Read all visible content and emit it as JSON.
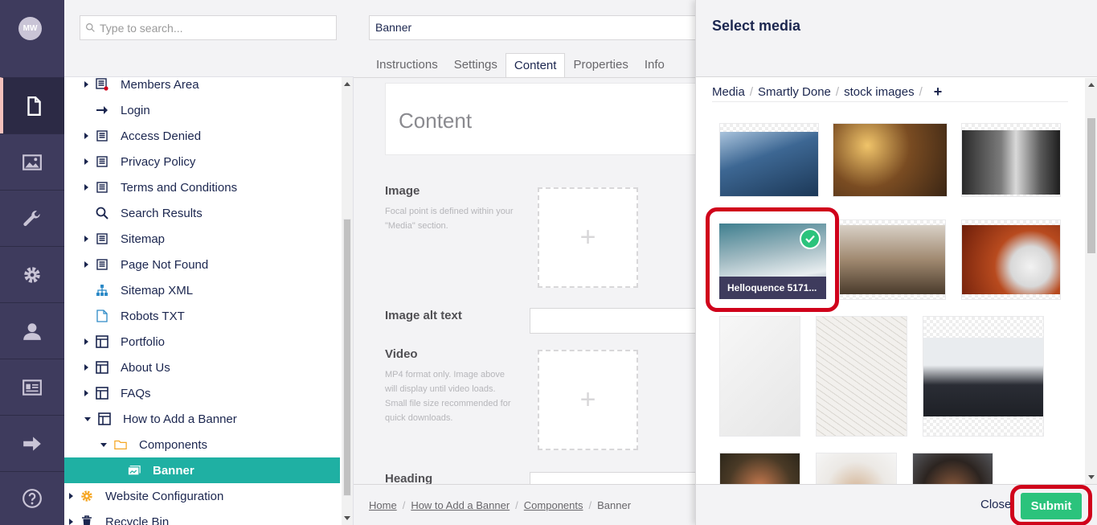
{
  "user": {
    "initials": "MW"
  },
  "sections": [
    {
      "name": "content",
      "icon": "document-icon",
      "active": true
    },
    {
      "name": "media",
      "icon": "image-icon"
    },
    {
      "name": "settings",
      "icon": "wrench-icon"
    },
    {
      "name": "packages",
      "icon": "gear-icon"
    },
    {
      "name": "users",
      "icon": "user-icon"
    },
    {
      "name": "members",
      "icon": "id-card-icon"
    },
    {
      "name": "forms",
      "icon": "arrow-right-icon"
    },
    {
      "name": "help",
      "icon": "help-icon"
    }
  ],
  "tree": {
    "search_placeholder": "Type to search...",
    "items": [
      {
        "label": "Members Area",
        "icon": "page-locked-icon",
        "caret": "right",
        "indent": 1
      },
      {
        "label": "Login",
        "icon": "arrow-right-icon",
        "caret": "none",
        "indent": 1
      },
      {
        "label": "Access Denied",
        "icon": "page-icon",
        "caret": "right",
        "indent": 1
      },
      {
        "label": "Privacy Policy",
        "icon": "page-icon",
        "caret": "right",
        "indent": 1
      },
      {
        "label": "Terms and Conditions",
        "icon": "page-icon",
        "caret": "right",
        "indent": 1
      },
      {
        "label": "Search Results",
        "icon": "search-icon",
        "caret": "none",
        "indent": 1
      },
      {
        "label": "Sitemap",
        "icon": "page-icon",
        "caret": "right",
        "indent": 1
      },
      {
        "label": "Page Not Found",
        "icon": "page-icon",
        "caret": "right",
        "indent": 1
      },
      {
        "label": "Sitemap XML",
        "icon": "sitemap-icon",
        "caret": "none",
        "indent": 1
      },
      {
        "label": "Robots TXT",
        "icon": "file-icon",
        "caret": "none",
        "indent": 1
      },
      {
        "label": "Portfolio",
        "icon": "layout-icon",
        "caret": "right",
        "indent": 1
      },
      {
        "label": "About Us",
        "icon": "layout-icon",
        "caret": "right",
        "indent": 1
      },
      {
        "label": "FAQs",
        "icon": "layout-icon",
        "caret": "right",
        "indent": 1
      },
      {
        "label": "How to Add a Banner",
        "icon": "layout-icon",
        "caret": "down",
        "indent": 1
      },
      {
        "label": "Components",
        "icon": "folder-icon",
        "caret": "down",
        "indent": 2
      },
      {
        "label": "Banner",
        "icon": "banner-icon",
        "caret": "none",
        "indent": 3,
        "selected": true
      },
      {
        "label": "Website Configuration",
        "icon": "gear-icon",
        "caret": "right",
        "indent": 0
      },
      {
        "label": "Recycle Bin",
        "icon": "trash-icon",
        "caret": "right",
        "indent": 0
      }
    ]
  },
  "editor": {
    "name": "Banner",
    "tabs": [
      "Instructions",
      "Settings",
      "Content",
      "Properties",
      "Info"
    ],
    "active_tab": "Content",
    "content_title": "Content",
    "image_label": "Image",
    "image_desc": "Focal point is defined within your \"Media\" section.",
    "alt_label": "Image alt text",
    "video_label": "Video",
    "video_desc": "MP4 format only. Image above will display until video loads. Small file size recommended for quick downloads.",
    "heading_label": "Heading",
    "breadcrumb": [
      "Home",
      "How to Add a Banner",
      "Components",
      "Banner"
    ]
  },
  "dialog": {
    "title": "Select media",
    "crumbs": [
      "Media",
      "Smartly Done",
      "stock images"
    ],
    "add_symbol": "+",
    "selected_caption": "Helloquence 5171...",
    "close_label": "Close",
    "submit_label": "Submit"
  },
  "colors": {
    "accent": "#1fb0a3",
    "submit": "#2bc37c",
    "nav": "#3e3b5d",
    "highlight": "#d0021b"
  }
}
